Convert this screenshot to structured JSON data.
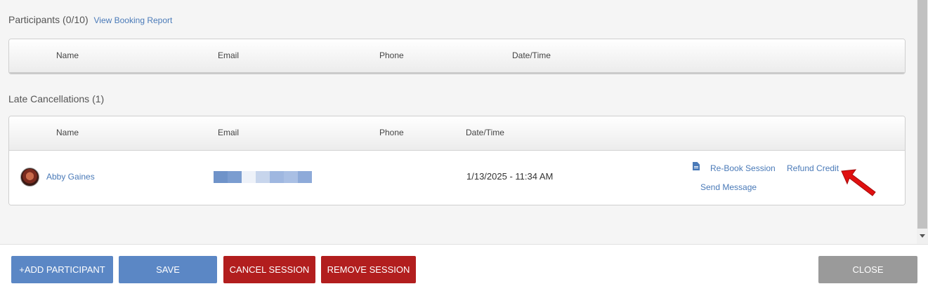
{
  "participants": {
    "title": "Participants (0/10)",
    "report_link": "View Booking Report",
    "columns": [
      "Name",
      "Email",
      "Phone",
      "Date/Time"
    ]
  },
  "late_cancellations": {
    "title": "Late Cancellations (1)",
    "columns": [
      "Name",
      "Email",
      "Phone",
      "Date/Time"
    ],
    "rows": [
      {
        "name": "Abby Gaines",
        "email": "",
        "phone": "",
        "datetime": "1/13/2025 - 11:34 AM",
        "actions": {
          "rebook": "Re-Book Session",
          "refund": "Refund Credit",
          "message": "Send Message"
        }
      }
    ]
  },
  "footer": {
    "add_participant": "+ADD PARTICIPANT",
    "save": "SAVE",
    "cancel_session": "CANCEL SESSION",
    "remove_session": "REMOVE SESSION",
    "close": "CLOSE"
  },
  "colors": {
    "link": "#4a7ab8",
    "primary_button": "#5b87c5",
    "danger_button": "#b21e1e",
    "neutral_button": "#9a9a9a",
    "annotation_arrow": "#e01010"
  },
  "icons": {
    "rebook": "document-icon",
    "annotation": "red-arrow-icon"
  }
}
